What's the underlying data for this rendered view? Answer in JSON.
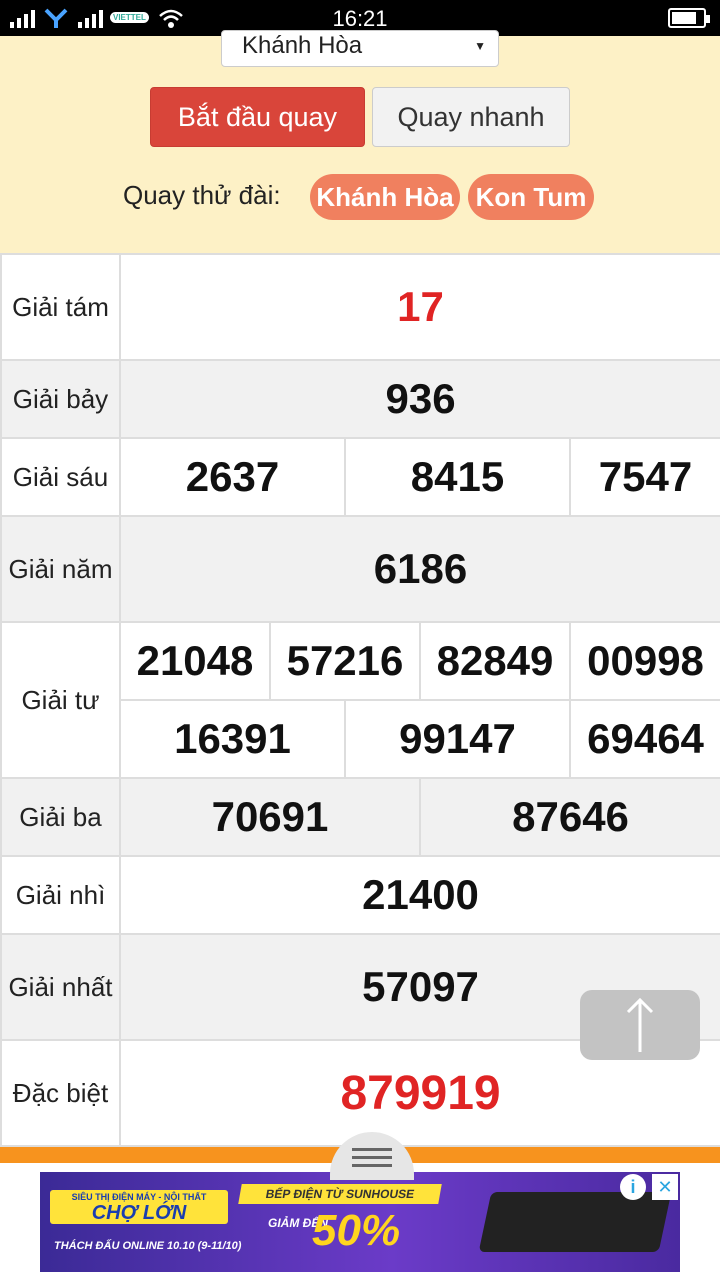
{
  "status_bar": {
    "time": "16:21",
    "carrier": "VIETTEL"
  },
  "selector": {
    "selected": "Khánh Hòa"
  },
  "buttons": {
    "start": "Bắt đầu quay",
    "quick": "Quay nhanh"
  },
  "try_station": {
    "label": "Quay thử đài:",
    "stations": [
      "Khánh Hòa",
      "Kon Tum"
    ]
  },
  "results": {
    "g8": {
      "label": "Giải tám",
      "numbers": [
        "17"
      ]
    },
    "g7": {
      "label": "Giải bảy",
      "numbers": [
        "936"
      ]
    },
    "g6": {
      "label": "Giải sáu",
      "numbers": [
        "2637",
        "8415",
        "7547"
      ]
    },
    "g5": {
      "label": "Giải năm",
      "numbers": [
        "6186"
      ]
    },
    "g4": {
      "label": "Giải tư",
      "numbers": [
        "21048",
        "57216",
        "82849",
        "00998",
        "16391",
        "99147",
        "69464"
      ]
    },
    "g3": {
      "label": "Giải ba",
      "numbers": [
        "70691",
        "87646"
      ]
    },
    "g2": {
      "label": "Giải nhì",
      "numbers": [
        "21400"
      ]
    },
    "g1": {
      "label": "Giải nhất",
      "numbers": [
        "57097"
      ]
    },
    "db": {
      "label": "Đặc biệt",
      "numbers": [
        "879919"
      ]
    }
  },
  "colors": {
    "accent_red": "#e02424",
    "button_red": "#d9453a",
    "pill": "#f0805f",
    "panel": "#fdf1c6",
    "orange_bar": "#f7931e"
  },
  "icons": {
    "scroll_top": "arrow-up-icon",
    "drawer": "menu-icon"
  },
  "ad": {
    "brand": "CHỢ LỚN",
    "tagline": "SIÊU THỊ ĐIỆN MÁY - NỘI THẤT",
    "promo": "THÁCH ĐẤU ONLINE 10.10",
    "promo_dates": "(9-11/10)",
    "headline": "BẾP ĐIỆN TỪ SUNHOUSE",
    "discount_prefix": "GIẢM ĐẾN",
    "discount": "50%"
  }
}
